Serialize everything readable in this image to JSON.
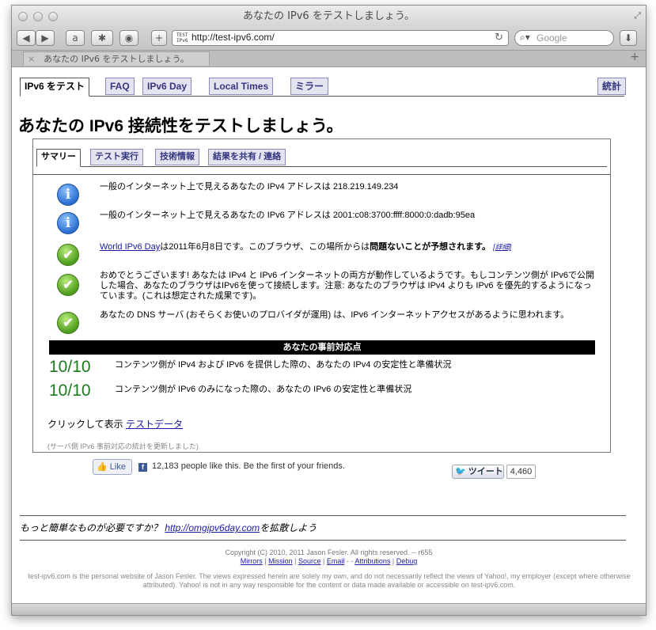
{
  "window": {
    "title": "あなたの IPv6 をテストしましょう。",
    "tab_title": "あなたの IPv6 をテストしましょう。",
    "url": "http://test-ipv6.com/",
    "search_placeholder": "Google",
    "favicon_text": "TEST IPv6"
  },
  "nav": {
    "tabs": [
      "IPv6 をテスト",
      "FAQ",
      "IPv6 Day",
      "Local Times",
      "ミラー"
    ],
    "stats": "統計"
  },
  "page_title": "あなたの IPv6 接続性をテストしましょう。",
  "subtabs": [
    "サマリー",
    "テスト実行",
    "技術情報",
    "結果を共有 / 連絡"
  ],
  "results": {
    "ipv4_text": "一般のインターネット上で見えるあなたの IPv4 アドレスは 218.219.149.234",
    "ipv6_text": "一般のインターネット上で見えるあなたの IPv6 アドレスは 2001:c08:3700:ffff:8000:0:dadb:95ea",
    "world_day_link": "World IPv6 Day",
    "world_day_text": "は2011年6月8日です。このブラウザ、この場所からは",
    "world_day_bold": "問題ないことが予想されます。",
    "world_day_detail": "[詳細]",
    "dual_stack_text": "おめでとうございます! あなたは IPv4 と IPv6 インターネットの両方が動作しているようです。もしコンテンツ側が IPv6で公開した場合、あなたのブラウザはIPv6を使って接続します。注意: あなたのブラウザは IPv4 よりも IPv6 を優先的するようになっています。(これは想定された成果です)。",
    "dns_text": "あなたの DNS サーバ (おそらくお使いのプロバイダが運用) は、IPv6 インターネットアクセスがあるように思われます。"
  },
  "readiness": {
    "header": "あなたの事前対応点",
    "scores": [
      {
        "score": "10/10",
        "text": "コンテンツ側が IPv4 および IPv6 を提供した際の、あなたの IPv4 の安定性と準備状況"
      },
      {
        "score": "10/10",
        "text": "コンテンツ側が IPv6 のみになった際の、あなたの IPv6 の安定性と準備状況"
      }
    ]
  },
  "click_show": {
    "prefix": "クリックして表示 ",
    "link": "テストデータ"
  },
  "footnote": "(サーバ側 IPv6 事前対応の統計を更新しました)",
  "social": {
    "like_label": "Like",
    "like_text": "12,183 people like this. Be the first of your friends.",
    "tweet_label": "ツイート",
    "tweet_count": "4,460"
  },
  "promo": {
    "prefix": "もっと簡単なものが必要ですか？ ",
    "link": "http://omgipv6day.com",
    "suffix": "を拡散しよう"
  },
  "footer": {
    "copyright": "Copyright (C) 2010, 2011 Jason Fesler. All rights reserved. -- r655",
    "links": [
      "Mirrors",
      "Mission",
      "Source",
      "Email"
    ],
    "dash": "-",
    "links2": [
      "Attributions",
      "Debug"
    ],
    "disclaimer": "test-ipv6.com is the personal website of Jason Fesler. The views expressed herein are solely my own, and do not necessarily reflect the views of Yahoo!, my employer (except where otherwise attributed). Yahoo! is not in any way responsible for the content or data made available or accessible on test-ipv6.com."
  },
  "icons": {
    "back": "back-arrow-icon",
    "forward": "forward-arrow-icon",
    "info": "info-icon",
    "ok": "checkmark-icon"
  },
  "colors": {
    "score_green": "#1e7a1e",
    "tab_bg": "#e4e4f0",
    "tab_text": "#353580",
    "link": "#1a1aa6"
  }
}
